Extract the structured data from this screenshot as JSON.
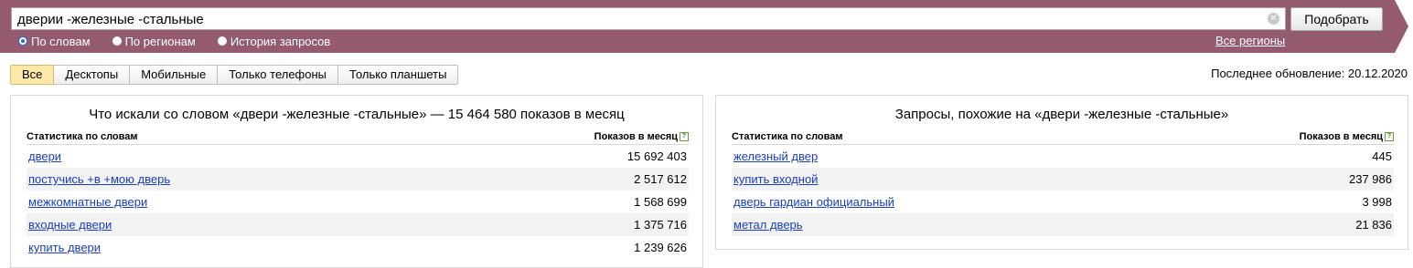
{
  "search": {
    "query": "дверии -железные -стальные",
    "submit_label": "Подобрать",
    "clear_icon": "✕",
    "modes": [
      "По словам",
      "По регионам",
      "История запросов"
    ],
    "regions_link": "Все регионы"
  },
  "tabs": [
    "Все",
    "Десктопы",
    "Мобильные",
    "Только телефоны",
    "Только планшеты"
  ],
  "last_update": "Последнее обновление: 20.12.2020",
  "left_panel": {
    "title": "Что искали со словом «двери -железные -стальные» — 15 464 580 показов в месяц",
    "col_keyword": "Статистика по словам",
    "col_count": "Показов в месяц",
    "rows": [
      {
        "keyword": "двери",
        "count": "15 692 403"
      },
      {
        "keyword": "постучись +в +мою дверь",
        "count": "2 517 612"
      },
      {
        "keyword": "межкомнатные двери",
        "count": "1 568 699"
      },
      {
        "keyword": "входные двери",
        "count": "1 375 716"
      },
      {
        "keyword": "купить двери",
        "count": "1 239 626"
      }
    ]
  },
  "right_panel": {
    "title": "Запросы, похожие на «двери -железные -стальные»",
    "col_keyword": "Статистика по словам",
    "col_count": "Показов в месяц",
    "rows": [
      {
        "keyword": "железный двер",
        "count": "445"
      },
      {
        "keyword": "купить входной",
        "count": "237 986"
      },
      {
        "keyword": "дверь гардиан официальный",
        "count": "3 998"
      },
      {
        "keyword": "метал дверь",
        "count": "21 836"
      }
    ]
  },
  "colors": {
    "header": "#935a70",
    "link": "#1a3dc1",
    "active_tab": "#fde8a8"
  }
}
